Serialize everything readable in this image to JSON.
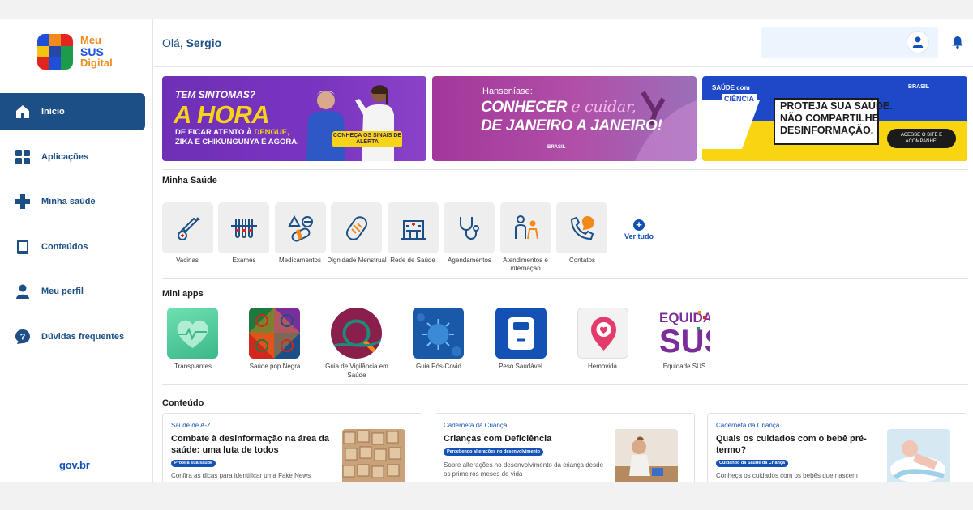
{
  "sidebar": {
    "logo": {
      "line1": "Meu",
      "line2": "SUS",
      "line3": "Digital"
    },
    "items": [
      {
        "label": "Início",
        "icon": "home-icon",
        "active": true
      },
      {
        "label": "Aplicações",
        "icon": "grid-icon"
      },
      {
        "label": "Minha saúde",
        "icon": "health-cross-icon"
      },
      {
        "label": "Conteúdos",
        "icon": "book-icon"
      },
      {
        "label": "Meu perfil",
        "icon": "person-icon"
      },
      {
        "label": "Dúvidas frequentes",
        "icon": "question-bubble-icon"
      }
    ],
    "footer": "gov.br"
  },
  "header": {
    "greeting": "Olá,",
    "user": "Sergio"
  },
  "banners": {
    "b1": {
      "tag": "TEM SINTOMAS?",
      "big": "A HORA",
      "sub1a": "DE FICAR ATENTO À ",
      "sub1b": "DENGUE,",
      "sub2": "ZIKA E CHIKUNGUNYA É AGORA.",
      "cta": "CONHEÇA OS SINAIS DE ALERTA"
    },
    "b2": {
      "small": "Hanseníase:",
      "line1a": "CONHECER ",
      "line1b": "e cuidar,",
      "line2": "DE JANEIRO A JANEIRO!",
      "logos": "BRASIL"
    },
    "b3": {
      "saude": "SAÚDE com",
      "ciencia": "CIÊNCIA",
      "msg1": "PROTEJA SUA SAÚDE.",
      "msg2": "NÃO COMPARTILHE",
      "msg3": "DESINFORMAÇÃO.",
      "cta": "ACESSE O SITE E ACOMPANHE!",
      "gov": "BRASIL"
    }
  },
  "minha_saude": {
    "title": "Minha Saúde",
    "tiles": [
      {
        "label": "Vacinas",
        "icon": "vaccine-icon"
      },
      {
        "label": "Exames",
        "icon": "test-tubes-icon"
      },
      {
        "label": "Medicamentos",
        "icon": "pills-icon"
      },
      {
        "label": "Dignidade Menstrual",
        "icon": "pad-icon"
      },
      {
        "label": "Rede de Saúde",
        "icon": "hospital-icon"
      },
      {
        "label": "Agendamentos",
        "icon": "stethoscope-icon"
      },
      {
        "label": "Atendimentos e internação",
        "icon": "patient-icon"
      },
      {
        "label": "Contatos",
        "icon": "phone-chat-icon"
      }
    ],
    "see_all": "Ver tudo"
  },
  "mini_apps": {
    "title": "Mini apps",
    "apps": [
      {
        "label": "Transplantes",
        "icon": "heart-pulse-icon"
      },
      {
        "label": "Saúde pop Negra",
        "icon": "pop-negra-icon"
      },
      {
        "label": "Guia de Vigilância em Saúde",
        "icon": "vigilancia-icon"
      },
      {
        "label": "Guia Pós-Covid",
        "icon": "virus-icon"
      },
      {
        "label": "Peso Saudável",
        "icon": "scale-icon"
      },
      {
        "label": "Hemovida",
        "icon": "blood-drop-pin-icon"
      },
      {
        "label": "Equidade SUS",
        "icon": "equidade-logo-icon"
      }
    ]
  },
  "conteudo": {
    "title": "Conteúdo",
    "cards": [
      {
        "category": "Saúde de A-Z",
        "title": "Combate à desinformação na área da saúde: uma luta de todos",
        "tag": "Proteja sua saúde",
        "desc": "Confira as dicas para identificar uma Fake News"
      },
      {
        "category": "Caderneta da Criança",
        "title": "Crianças com Deficiência",
        "tag": "Percebendo alterações no desenvolvimento",
        "desc": "Sobre alterações no desenvolvimento da criança desde os primeiros meses de vida"
      },
      {
        "category": "Caderneta da Criança",
        "title": "Quais os cuidados com o bebê pré-termo?",
        "tag": "Cuidando da Saúde da Criança",
        "desc": "Conheça os cuidados com os bebês que nascem"
      }
    ]
  },
  "colors": {
    "primary": "#1c4f86",
    "link": "#1351b4",
    "yellow": "#f7d417"
  }
}
